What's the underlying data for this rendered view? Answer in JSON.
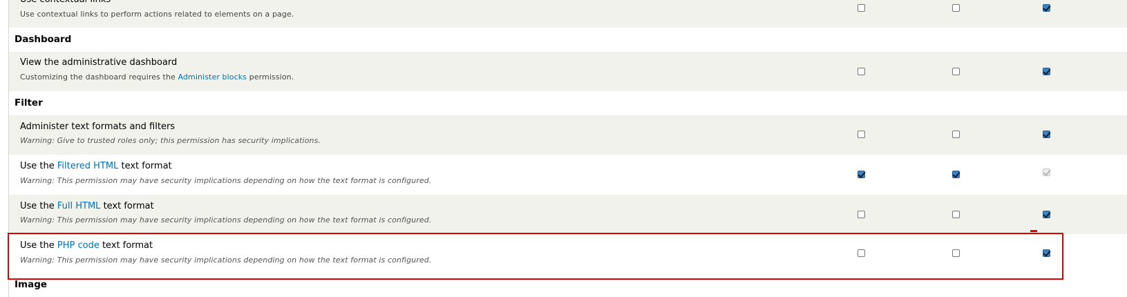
{
  "rows": {
    "contextual": {
      "title": "Use contextual links",
      "desc": "Use contextual links to perform actions related to elements on a page.",
      "checks": [
        false,
        false,
        true
      ]
    },
    "dashboard_header": "Dashboard",
    "dashboard": {
      "title": "View the administrative dashboard",
      "desc_before": "Customizing the dashboard requires the ",
      "desc_link": "Administer blocks",
      "desc_after": " permission.",
      "checks": [
        false,
        false,
        true
      ]
    },
    "filter_header": "Filter",
    "administer_formats": {
      "title": "Administer text formats and filters",
      "desc": "Warning: Give to trusted roles only; this permission has security implications.",
      "checks": [
        false,
        false,
        true
      ]
    },
    "filtered_html": {
      "title_before": "Use the ",
      "title_link": "Filtered HTML",
      "title_after": " text format",
      "desc": "Warning: This permission may have security implications depending on how the text format is configured.",
      "checks": [
        true,
        true,
        "disabled"
      ]
    },
    "full_html": {
      "title_before": "Use the ",
      "title_link": "Full HTML",
      "title_after": " text format",
      "desc": "Warning: This permission may have security implications depending on how the text format is configured.",
      "checks": [
        false,
        false,
        true
      ]
    },
    "php_code": {
      "title_before": "Use the ",
      "title_link": "PHP code",
      "title_after": " text format",
      "desc": "Warning: This permission may have security implications depending on how the text format is configured.",
      "checks": [
        false,
        false,
        true
      ]
    },
    "image_header": "Image"
  },
  "colors": {
    "link": "#0071b3",
    "highlight": "#e00000",
    "row_stripe": "#f2f2ed",
    "checkbox_checked": "#3a82c4"
  }
}
